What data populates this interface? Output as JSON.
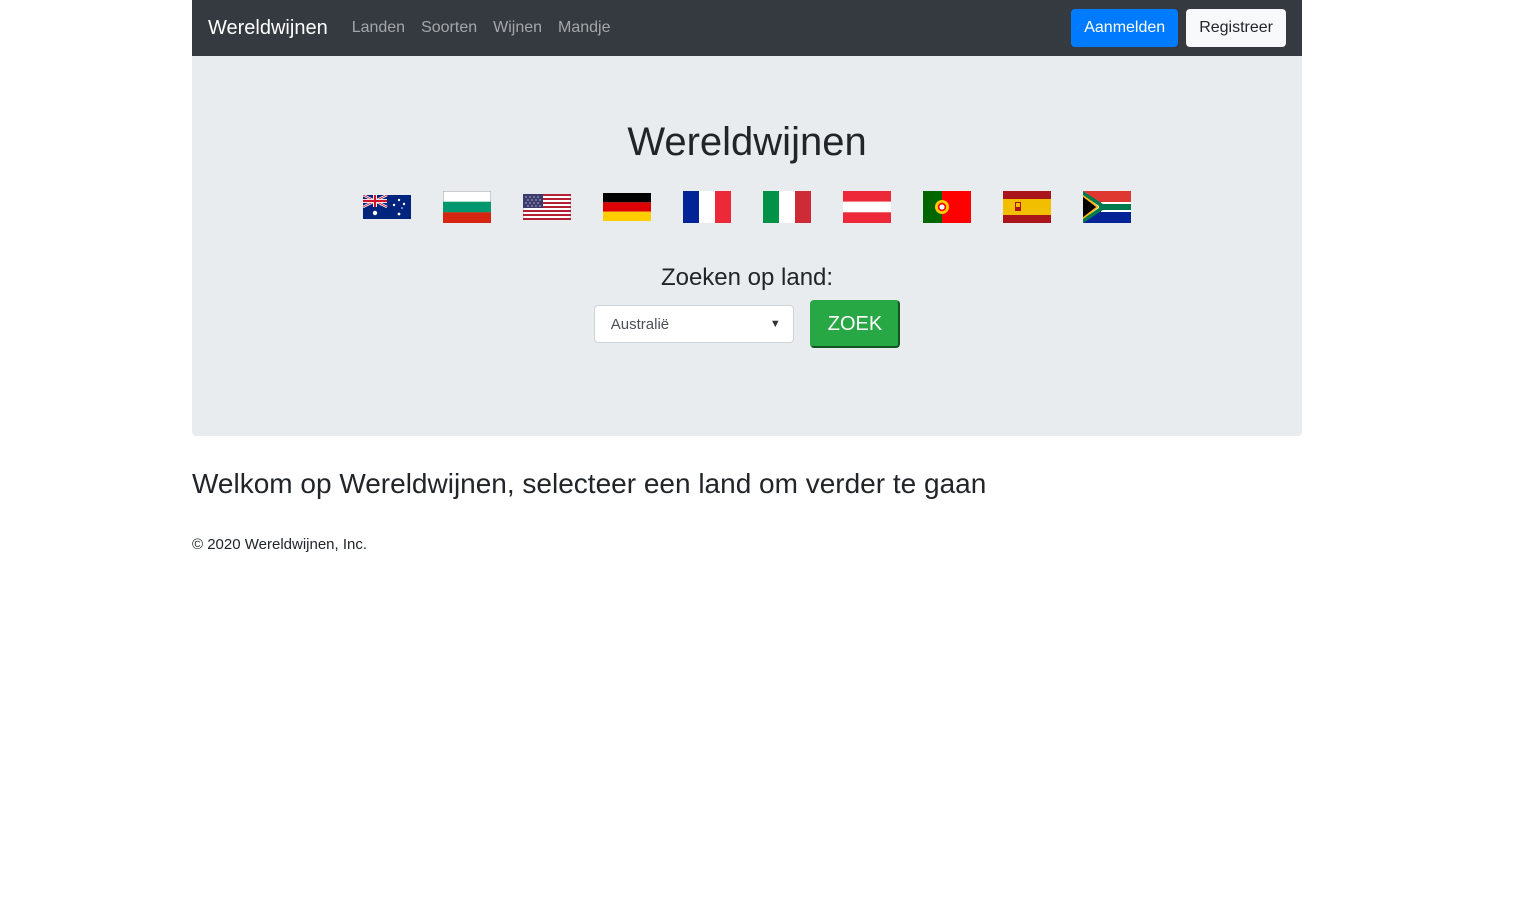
{
  "navbar": {
    "brand": "Wereldwijnen",
    "links": [
      "Landen",
      "Soorten",
      "Wijnen",
      "Mandje"
    ],
    "login_label": "Aanmelden",
    "register_label": "Registreer"
  },
  "hero": {
    "title": "Wereldwijnen",
    "flags": [
      "australia-flag",
      "bulgaria-flag",
      "usa-flag",
      "germany-flag",
      "france-flag",
      "italy-flag",
      "austria-flag",
      "portugal-flag",
      "spain-flag",
      "south-africa-flag"
    ],
    "search_label": "Zoeken op land:",
    "country_select_value": "Australië",
    "search_button_label": "ZOEK"
  },
  "welcome_text": "Welkom op Wereldwijnen, selecteer een land om verder te gaan",
  "footer_text": "© 2020 Wereldwijnen, Inc.",
  "colors": {
    "navbar_bg": "#343a40",
    "primary": "#007bff",
    "success": "#28a745",
    "jumbotron_bg": "#e9ecef"
  }
}
